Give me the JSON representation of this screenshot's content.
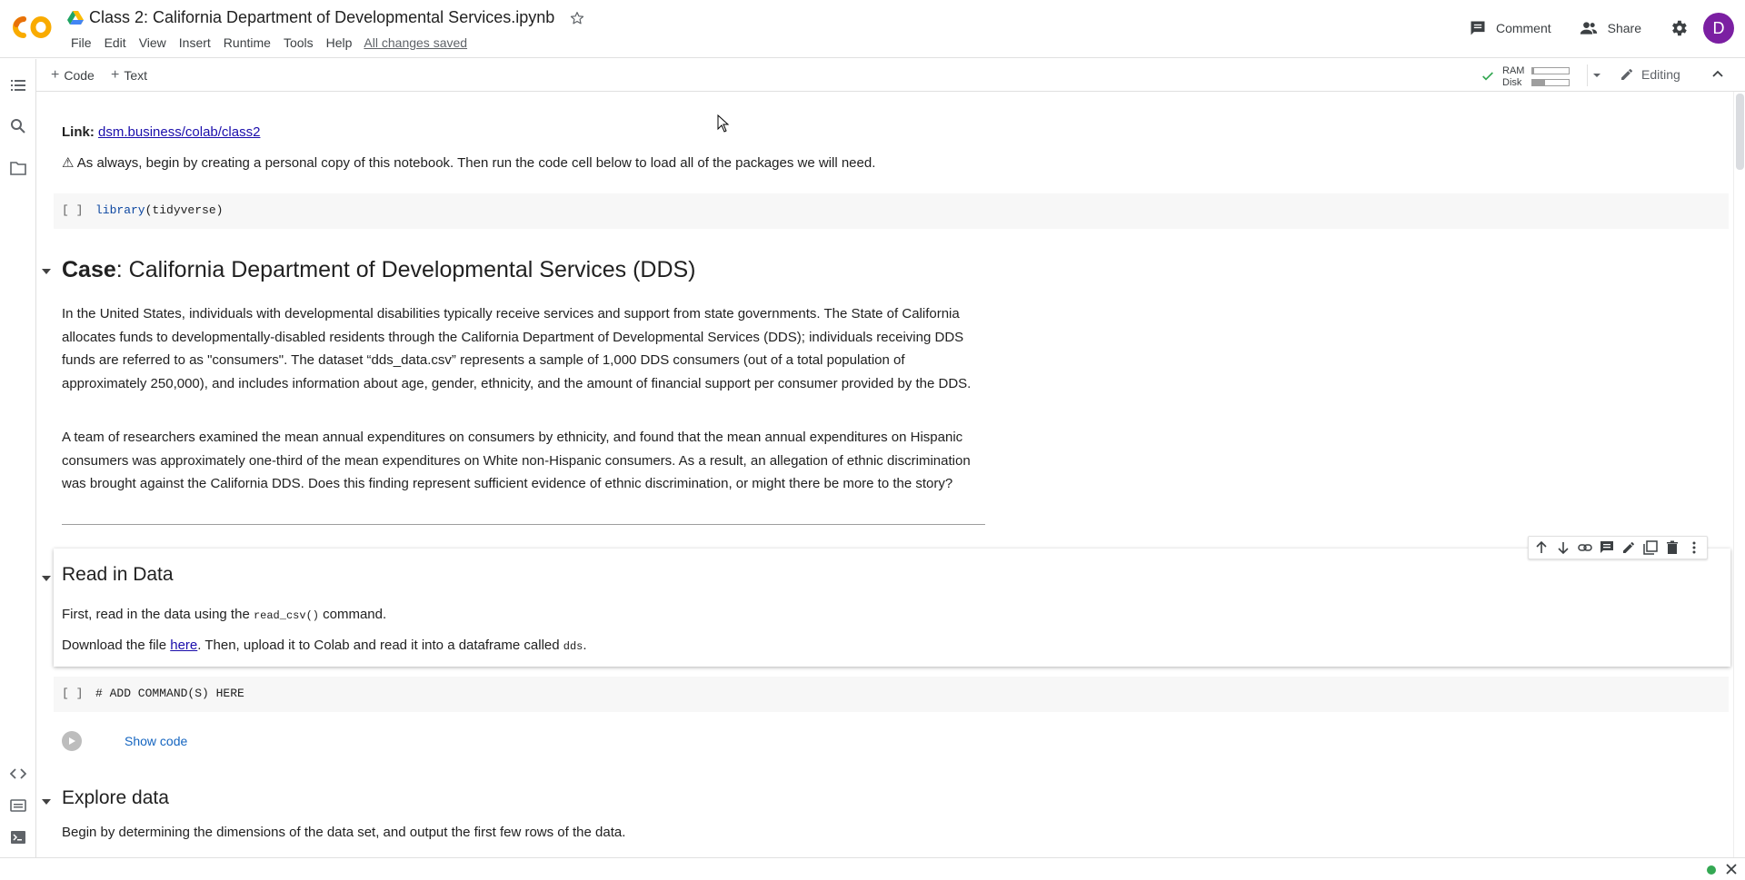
{
  "header": {
    "logo": "CO",
    "title": "Class 2: California Department of Developmental Services.ipynb",
    "menu": [
      "File",
      "Edit",
      "View",
      "Insert",
      "Runtime",
      "Tools",
      "Help"
    ],
    "saved_status": "All changes saved",
    "comment_label": "Comment",
    "share_label": "Share",
    "avatar_letter": "D",
    "icons": [
      "drive-icon",
      "star-icon",
      "comment-icon",
      "share-icon",
      "gear-icon"
    ]
  },
  "toolbar": {
    "add_code": "Code",
    "add_text": "Text",
    "ram_label": "RAM",
    "disk_label": "Disk",
    "ram_usage": 0.05,
    "disk_usage": 0.35,
    "editing_label": "Editing"
  },
  "sidebar": {
    "icons": [
      "toc-icon",
      "search-icon",
      "folder-icon",
      "code-snippets-icon",
      "command-palette-icon",
      "terminal-icon"
    ]
  },
  "notebook": {
    "link_label": "Link:",
    "link_text": "dsm.business/colab/class2",
    "intro": "⚠ As always, begin by creating a personal copy of this notebook. Then run the code cell below to load all of the packages we will need.",
    "cell1": {
      "brackets": "[ ]",
      "fn": "library",
      "arg": "(tidyverse)"
    },
    "case_heading_bold": "Case",
    "case_heading_rest": ": California Department of Developmental Services (DDS)",
    "para1": "In the United States, individuals with developmental disabilities typically receive services and support from state governments. The State of California allocates funds to developmentally-disabled residents through the California Department of Developmental Services (DDS); individuals receiving DDS funds are referred to as \"consumers\". The dataset “dds_data.csv” represents a sample of 1,000 DDS consumers (out of a total population of approximately 250,000), and includes information about age, gender, ethnicity, and the amount of financial support per consumer provided by the DDS.",
    "para2": "A team of researchers examined the mean annual expenditures on consumers by ethnicity, and found that the mean annual expenditures on Hispanic consumers was approximately one-third of the mean expenditures on White non-Hispanic consumers. As a result, an allegation of ethnic discrimination was brought against the California DDS. Does this finding represent sufficient evidence of ethnic discrimination, or might there be more to the story?",
    "read_heading": "Read in Data",
    "read_p1_a": "First, read in the data using the ",
    "read_p1_code": "read_csv()",
    "read_p1_b": " command.",
    "read_p2_a": "Download the file ",
    "read_p2_link": "here",
    "read_p2_b": ". Then, upload it to Colab and read it into a dataframe called ",
    "read_p2_code": "dds",
    "read_p2_c": ".",
    "cell2": {
      "brackets": "[ ]",
      "comment": "# ADD COMMAND(S) HERE"
    },
    "show_code": "Show code",
    "explore_heading": "Explore data",
    "explore_p": "Begin by determining the dimensions of the data set, and output the first few rows of the data."
  },
  "cell_toolbar_icons": [
    "move-up-icon",
    "move-down-icon",
    "link-icon",
    "comment-icon",
    "edit-icon",
    "mirror-cell-icon",
    "delete-icon",
    "more-icon"
  ],
  "colors": {
    "accent": "#1a0dab",
    "avatar": "#7b1fa2",
    "logo_orange": "#f9ab00",
    "status_green": "#34a853"
  }
}
